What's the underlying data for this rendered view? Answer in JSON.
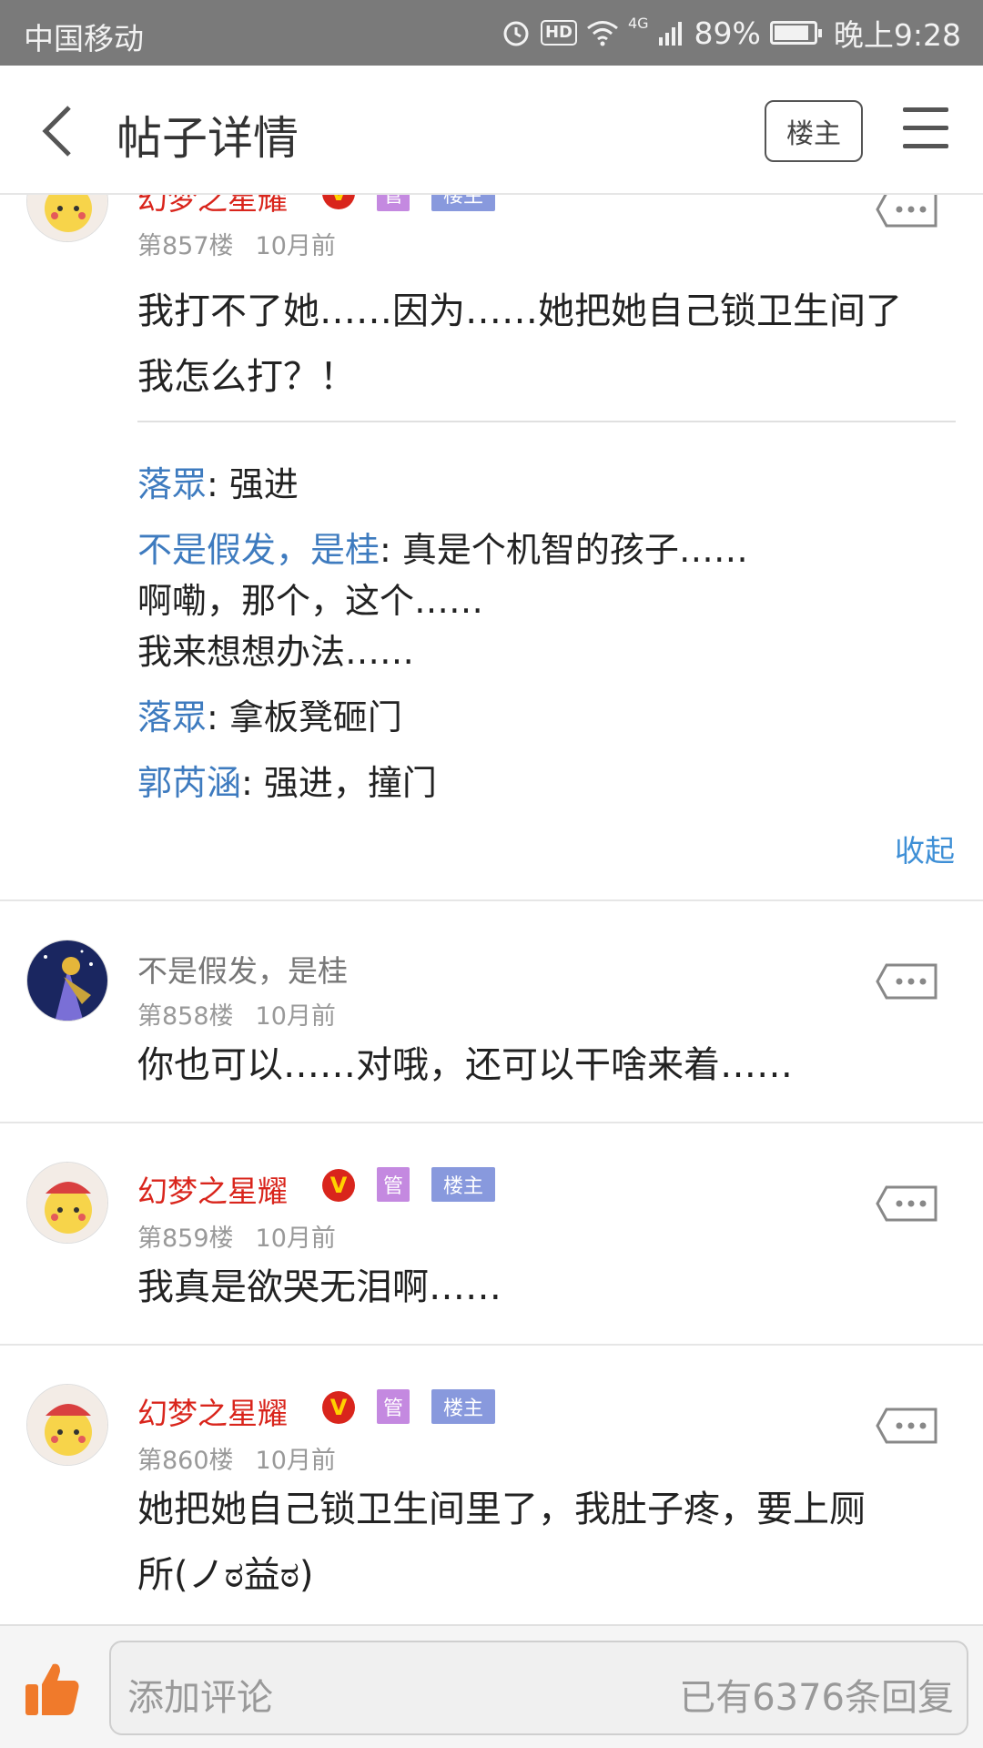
{
  "status": {
    "carrier": "中国移动",
    "network": "4G",
    "battery_pct": "89%",
    "time": "晚上9:28",
    "hd": "HD",
    "battery_level": 0.89
  },
  "header": {
    "title": "帖子详情",
    "owner_button": "楼主"
  },
  "post857": {
    "name": "幻梦之星耀",
    "v": "V",
    "tag_guan": "管",
    "tag_owner": "楼主",
    "floor": "第857楼",
    "time": "10月前",
    "line1": "我打不了她……因为……她把她自己锁卫生间了",
    "line2": "我怎么打？！",
    "replies": [
      {
        "name": "落眾",
        "text": ": 强进"
      },
      {
        "name": "不是假发，是桂",
        "text": ": 真是个机智的孩子……",
        "extra1": "啊嘞，那个，这个……",
        "extra2": "我来想想办法……"
      },
      {
        "name": "落眾",
        "text": ": 拿板凳砸门"
      },
      {
        "name": "郭芮涵",
        "text": ": 强进，撞门"
      }
    ],
    "collapse": "收起"
  },
  "post858": {
    "name": "不是假发，是桂",
    "floor": "第858楼",
    "time": "10月前",
    "text": "你也可以……对哦，还可以干啥来着……"
  },
  "post859": {
    "name": "幻梦之星耀",
    "v": "V",
    "tag_guan": "管",
    "tag_owner": "楼主",
    "floor": "第859楼",
    "time": "10月前",
    "text": "我真是欲哭无泪啊……"
  },
  "post860": {
    "name": "幻梦之星耀",
    "v": "V",
    "tag_guan": "管",
    "tag_owner": "楼主",
    "floor": "第860楼",
    "time": "10月前",
    "line1": "她把她自己锁卫生间里了，我肚子疼，要上厕",
    "line2": "所(ノಠ益ಠ)"
  },
  "bottom": {
    "placeholder": "添加评论",
    "reply_count": "已有6376条回复"
  }
}
